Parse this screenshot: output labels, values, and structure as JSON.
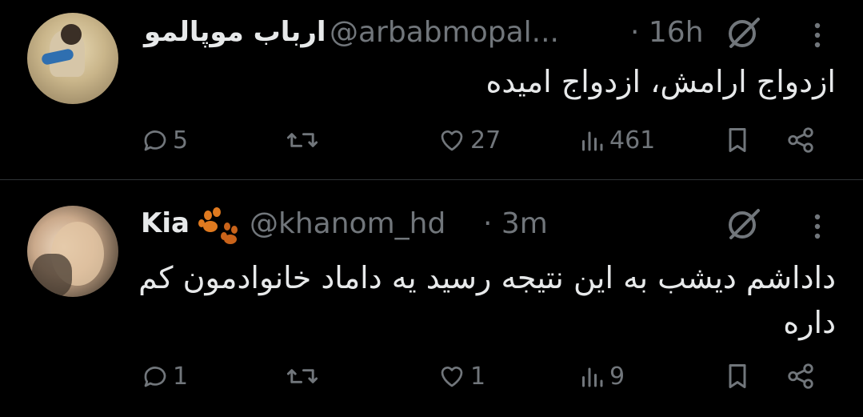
{
  "tweets": [
    {
      "display_name": "ارباب موپالمو",
      "handle": "@arbabmopal...",
      "time": "· 16h",
      "text": "ازدواج ارامش، ازدواج امیده",
      "replies": "5",
      "retweets": "",
      "likes": "27",
      "views": "461"
    },
    {
      "display_name": "Kia",
      "handle": "@khanom_hd",
      "time": "· 3m",
      "text": "داداشم دیشب به این نتیجه رسید یه داماد خانوادمون کم داره",
      "replies": "1",
      "retweets": "",
      "likes": "1",
      "views": "9"
    }
  ],
  "icons": [
    "grok-icon",
    "more-icon",
    "reply-icon",
    "retweet-icon",
    "like-icon",
    "views-icon",
    "bookmark-icon",
    "share-icon",
    "paw-icon"
  ],
  "colors": {
    "background": "#000000",
    "text": "#e7e9ea",
    "secondary": "#71767b",
    "divider": "#2f3336",
    "paw": "#e07a1f"
  }
}
